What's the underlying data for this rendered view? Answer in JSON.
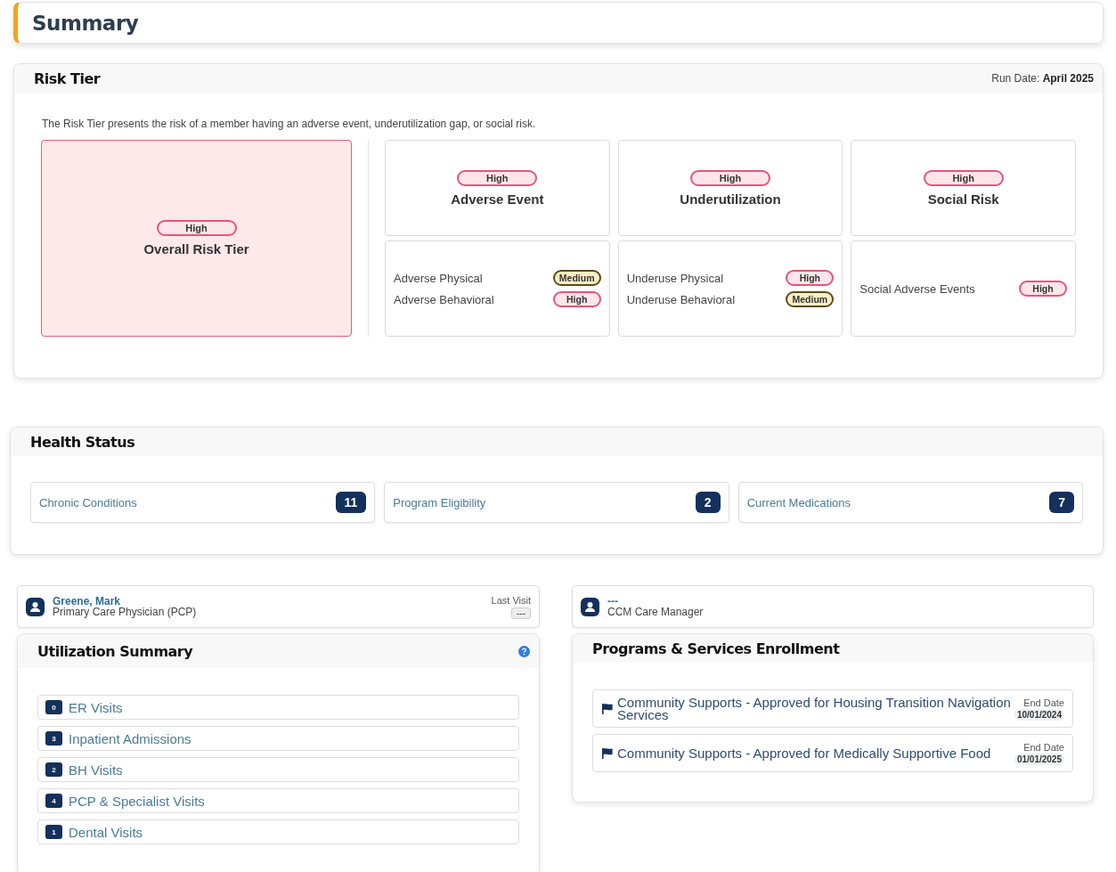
{
  "header": {
    "title": "Summary"
  },
  "risk_tier": {
    "title": "Risk Tier",
    "run_date": "Run Date: **April 2025**",
    "description": "The Risk Tier presents the risk of a member having an adverse event, underutilization gap, or social risk.",
    "overall": {
      "badge": "High",
      "kind": "high",
      "label": "Overall Risk Tier"
    },
    "categories": [
      {
        "badge": "High",
        "kind": "high",
        "label": "Adverse Event",
        "details": [
          {
            "label": "Adverse Physical",
            "badge": "Medium",
            "kind": "medium"
          },
          {
            "label": "Adverse Behavioral",
            "badge": "High",
            "kind": "high"
          }
        ]
      },
      {
        "badge": "High",
        "kind": "high",
        "label": "Underutilization",
        "details": [
          {
            "label": "Underuse Physical",
            "badge": "High",
            "kind": "high"
          },
          {
            "label": "Underuse Behavioral",
            "badge": "Medium",
            "kind": "medium"
          }
        ]
      },
      {
        "badge": "High",
        "kind": "high",
        "label": "Social Risk",
        "details": [
          {
            "label": "Social Adverse Events",
            "badge": "High",
            "kind": "high"
          }
        ]
      }
    ]
  },
  "health_status": {
    "title": "Health Status",
    "items": [
      {
        "label": "Chronic Conditions",
        "count": "11"
      },
      {
        "label": "Program Eligibility",
        "count": "2"
      },
      {
        "label": "Current Medications",
        "count": "7"
      }
    ]
  },
  "pcp": {
    "name": "Greene, Mark",
    "role": "Primary Care Physician (PCP)",
    "last_visit_label": "Last Visit",
    "last_visit": "---"
  },
  "utilization": {
    "title": "Utilization Summary",
    "items": [
      {
        "count": "0",
        "label": "ER Visits"
      },
      {
        "count": "3",
        "label": "Inpatient Admissions"
      },
      {
        "count": "2",
        "label": "BH Visits"
      },
      {
        "count": "4",
        "label": "PCP & Specialist Visits"
      },
      {
        "count": "1",
        "label": "Dental Visits"
      }
    ]
  },
  "care_manager": {
    "name": "---",
    "role": "CCM Care Manager"
  },
  "programs": {
    "title": "Programs & Services Enrollment",
    "items": [
      {
        "name": "Community Supports - Approved for Housing Transition Navigation Services",
        "end_date_label": "End Date",
        "end_date": "10/01/2024"
      },
      {
        "name": "Community Supports - Approved for Medically Supportive Food",
        "end_date_label": "End Date",
        "end_date": "01/01/2025"
      }
    ]
  }
}
